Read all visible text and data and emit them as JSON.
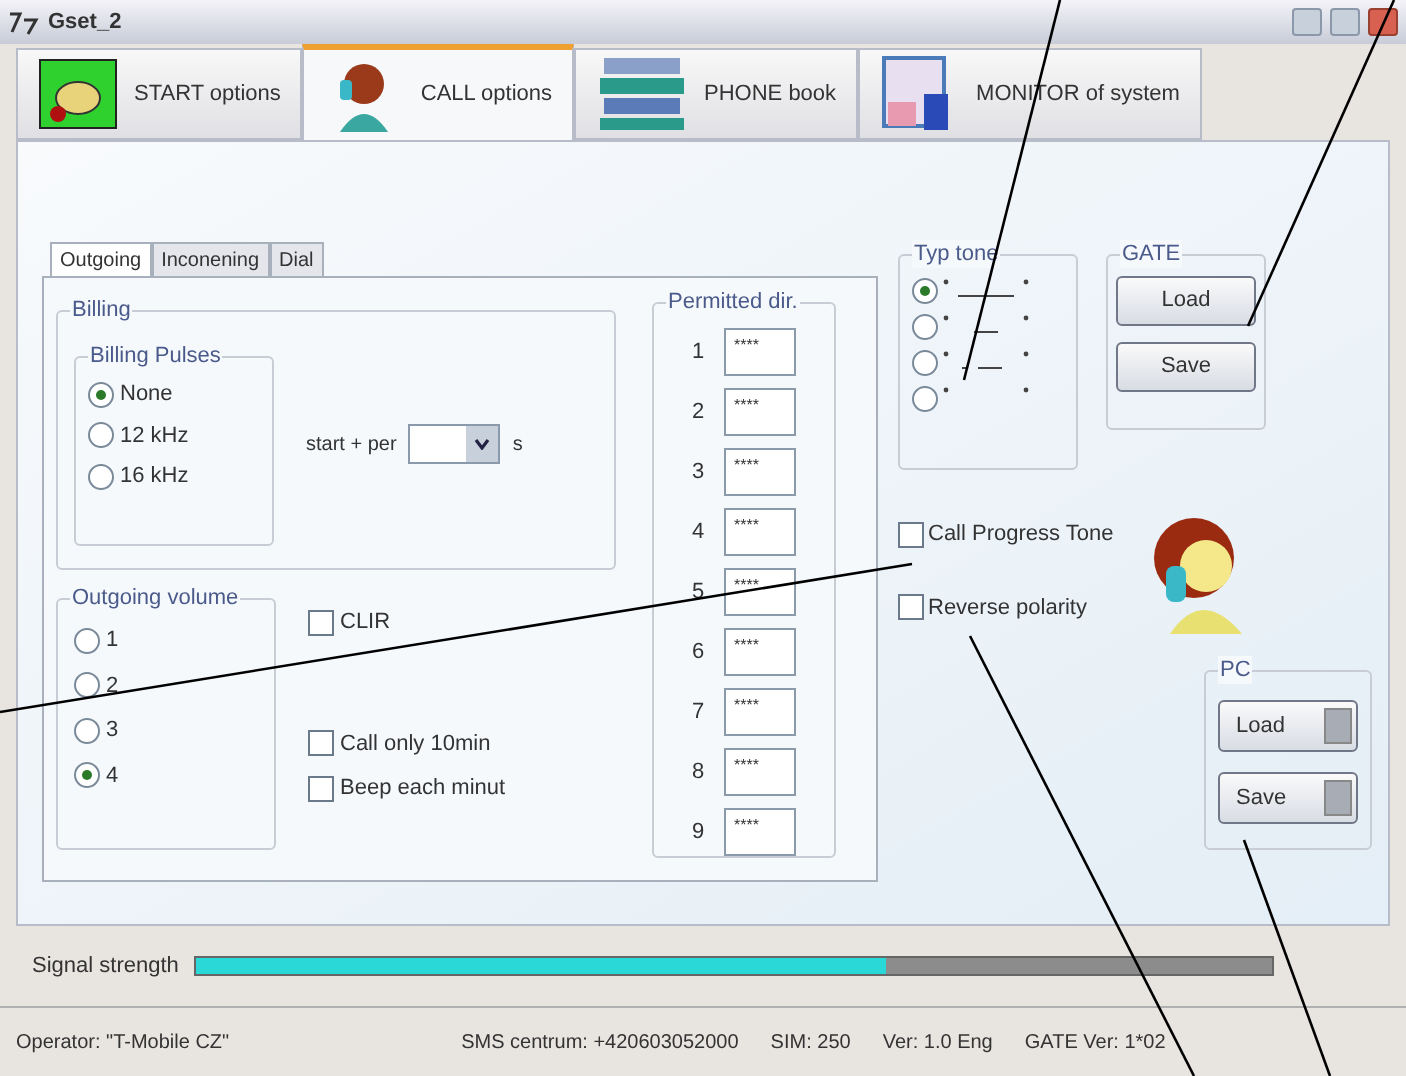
{
  "window": {
    "title": "Gset_2"
  },
  "main_tabs": [
    {
      "label": "START options",
      "selected": false,
      "kind": "start"
    },
    {
      "label": "CALL options",
      "selected": true,
      "kind": "call"
    },
    {
      "label": "PHONE book",
      "selected": false,
      "kind": "book"
    },
    {
      "label": "MONITOR of system",
      "selected": false,
      "kind": "monitor"
    }
  ],
  "sub_tabs": [
    {
      "label": "Outgoing",
      "selected": true
    },
    {
      "label": "Inconening",
      "selected": false
    },
    {
      "label": "Dial",
      "selected": false
    }
  ],
  "billing": {
    "title": "Billing",
    "pulses_title": "Billing Pulses",
    "pulses": [
      {
        "label": "None",
        "selected": true
      },
      {
        "label": "12 kHz",
        "selected": false
      },
      {
        "label": "16 kHz",
        "selected": false
      }
    ],
    "period_label": "start + per",
    "period_unit": "s"
  },
  "outgoing_volume": {
    "title": "Outgoing volume",
    "options": [
      {
        "label": "1",
        "selected": false
      },
      {
        "label": "2",
        "selected": false
      },
      {
        "label": "3",
        "selected": false
      },
      {
        "label": "4",
        "selected": true
      }
    ]
  },
  "checkboxes": [
    {
      "label": "CLIR",
      "checked": false
    },
    {
      "label": "Call only 10min",
      "checked": false
    },
    {
      "label": "Beep each minut",
      "checked": false
    }
  ],
  "permitted": {
    "title": "Permitted dir.",
    "rows": [
      {
        "number": "1",
        "value": "****"
      },
      {
        "number": "2",
        "value": "****"
      },
      {
        "number": "3",
        "value": "****"
      },
      {
        "number": "4",
        "value": "****"
      },
      {
        "number": "5",
        "value": "****"
      },
      {
        "number": "6",
        "value": "****"
      },
      {
        "number": "7",
        "value": "****"
      },
      {
        "number": "8",
        "value": "****"
      },
      {
        "number": "9",
        "value": "****"
      }
    ]
  },
  "typ_tone": {
    "title": "Typ tone",
    "options": [
      {
        "kind": "long",
        "selected": true
      },
      {
        "kind": "short",
        "selected": false
      },
      {
        "kind": "dashed",
        "selected": false
      },
      {
        "kind": "none",
        "selected": false
      }
    ]
  },
  "gate": {
    "title": "GATE",
    "buttons": [
      "Load",
      "Save"
    ]
  },
  "options": [
    {
      "label": "Call Progress Tone",
      "checked": false
    },
    {
      "label": "Reverse polarity",
      "checked": false
    }
  ],
  "pc": {
    "title": "PC",
    "buttons": [
      "Load",
      "Save"
    ]
  },
  "signal": {
    "label": "Signal strength",
    "level": 0.64
  },
  "status_bar": {
    "operator": "Operator: \"T-Mobile CZ\"",
    "sms": "SMS centrum: +420603052000",
    "sim": "SIM: 250",
    "version": "Ver: 1.0 Eng",
    "gate_version": "GATE Ver: 1*02"
  }
}
